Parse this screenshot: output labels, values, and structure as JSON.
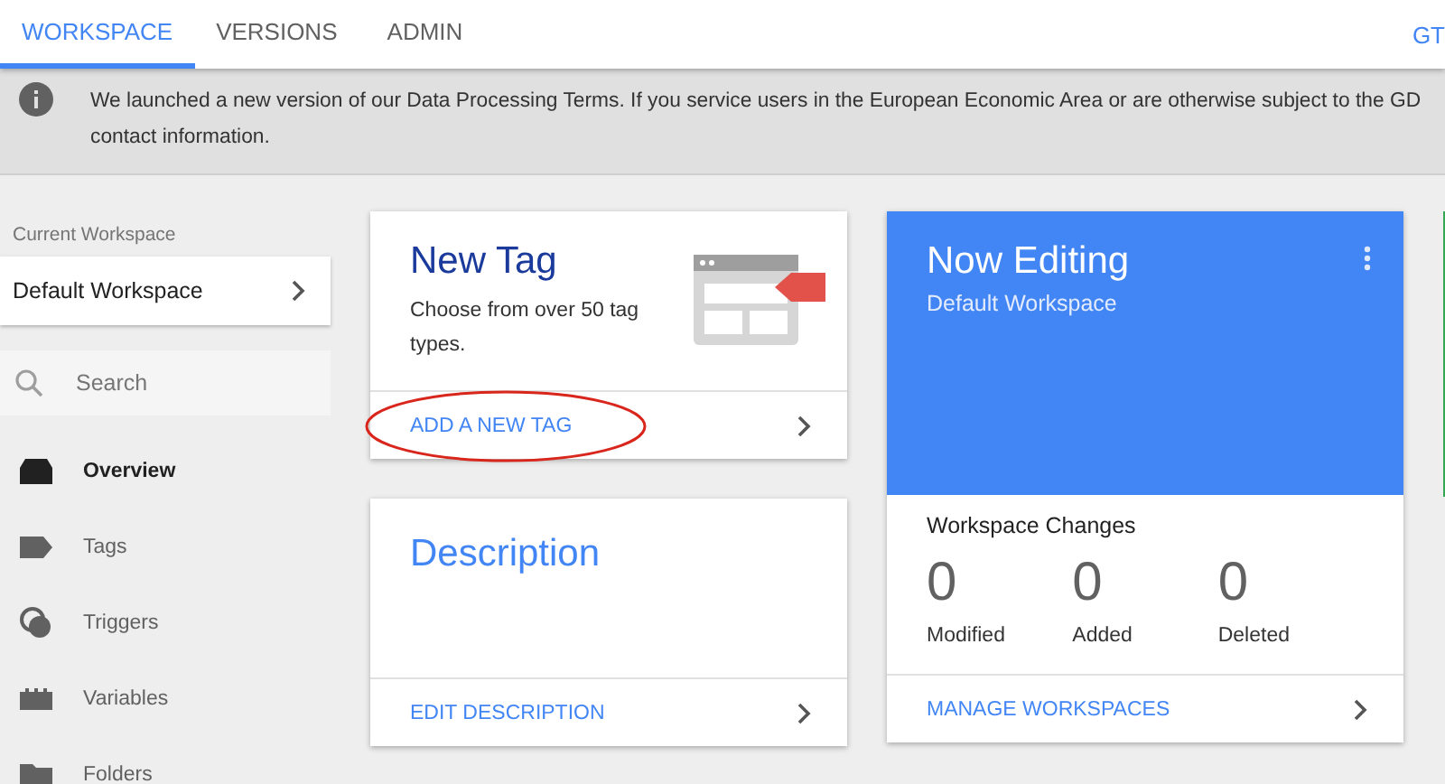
{
  "tabs": [
    {
      "label": "WORKSPACE",
      "selected": true
    },
    {
      "label": "VERSIONS",
      "selected": false
    },
    {
      "label": "ADMIN",
      "selected": false
    }
  ],
  "account_label": "GT",
  "notice": {
    "lines": [
      "We launched a new version of our Data Processing Terms. If you service users in the European Economic Area or are otherwise subject to the GD",
      "contact information."
    ]
  },
  "sidebar": {
    "workspace_label": "Current Workspace",
    "workspace_name": "Default Workspace",
    "search": {
      "placeholder": "Search"
    },
    "items": [
      {
        "label": "Overview",
        "kind": "overview",
        "selected": true
      },
      {
        "label": "Tags",
        "kind": "tags",
        "selected": false
      },
      {
        "label": "Triggers",
        "kind": "triggers",
        "selected": false
      },
      {
        "label": "Variables",
        "kind": "variables",
        "selected": false
      },
      {
        "label": "Folders",
        "kind": "folders",
        "selected": false
      }
    ]
  },
  "new_tag_card": {
    "title": "New Tag",
    "description": "Choose from over 50 tag types.",
    "action": "ADD A NEW TAG",
    "circled": true
  },
  "description_card": {
    "title": "Description",
    "action": "EDIT DESCRIPTION"
  },
  "now_editing_card": {
    "title": "Now Editing",
    "workspace": "Default Workspace",
    "changes_title": "Workspace Changes",
    "stats": [
      {
        "value": "0",
        "label": "Modified"
      },
      {
        "value": "0",
        "label": "Added"
      },
      {
        "value": "0",
        "label": "Deleted"
      }
    ],
    "action": "MANAGE WORKSPACES"
  }
}
